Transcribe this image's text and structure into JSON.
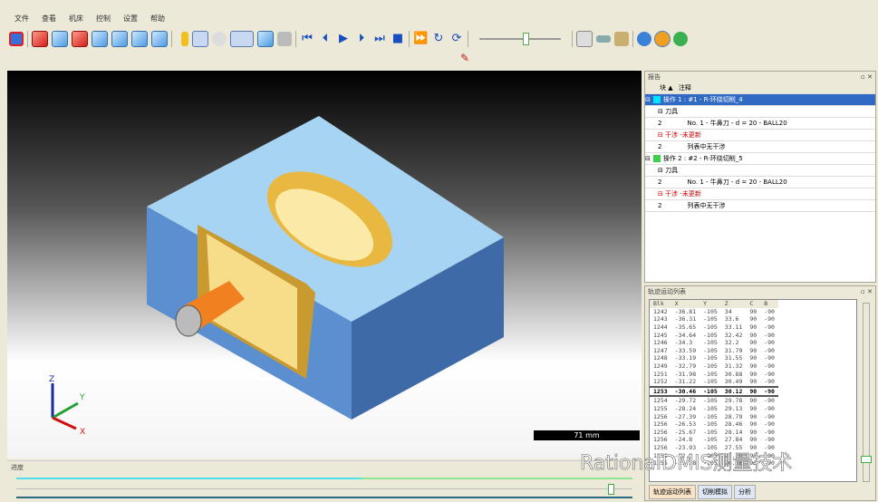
{
  "menu": [
    "文件",
    "查看",
    "机床",
    "控制",
    "设置",
    "帮助"
  ],
  "report": {
    "title": "报告",
    "col_block": "块",
    "col_note": "注释",
    "ops": [
      {
        "label": "操作 1 : #1 - R-环绕切削_4",
        "color": "#00e5ff",
        "tool_header": "刀具",
        "tool_block": "2",
        "tool": "No. 1 - 牛鼻刀 - d = 20 - BALL20",
        "coll_header": "干涉 -未更新",
        "coll_block": "2",
        "coll": "列表中无干涉"
      },
      {
        "label": "操作 2 : #2 - R-环绕切削_5",
        "color": "#3cd04a",
        "tool_header": "刀具",
        "tool_block": "2",
        "tool": "No. 1 - 牛鼻刀 - d = 20 - BALL20",
        "coll_header": "干涉 -未更新",
        "coll_block": "2",
        "coll": "列表中无干涉"
      }
    ]
  },
  "motion": {
    "title": "轨迹运动列表",
    "headers": [
      "Blk",
      "X",
      "Y",
      "Z",
      "C",
      "B"
    ],
    "current_row": 10,
    "rows": [
      [
        "1242",
        "-36.81",
        "-105",
        "34",
        "90",
        "-90"
      ],
      [
        "1243",
        "-36.31",
        "-105",
        "33.6",
        "90",
        "-90"
      ],
      [
        "1244",
        "-35.65",
        "-105",
        "33.11",
        "90",
        "-90"
      ],
      [
        "1245",
        "-34.64",
        "-105",
        "32.42",
        "90",
        "-90"
      ],
      [
        "1246",
        "-34.3",
        "-105",
        "32.2",
        "90",
        "-90"
      ],
      [
        "1247",
        "-33.59",
        "-105",
        "31.79",
        "90",
        "-90"
      ],
      [
        "1248",
        "-33.19",
        "-105",
        "31.55",
        "90",
        "-90"
      ],
      [
        "1249",
        "-32.79",
        "-105",
        "31.32",
        "90",
        "-90"
      ],
      [
        "1251",
        "-31.98",
        "-105",
        "30.88",
        "90",
        "-90"
      ],
      [
        "1252",
        "-31.22",
        "-105",
        "30.49",
        "90",
        "-90"
      ],
      [
        "1253",
        "-30.46",
        "-105",
        "30.12",
        "90",
        "-90"
      ],
      [
        "1254",
        "-29.72",
        "-105",
        "29.78",
        "90",
        "-90"
      ],
      [
        "1255",
        "-28.24",
        "-105",
        "29.13",
        "90",
        "-90"
      ],
      [
        "1256",
        "-27.39",
        "-105",
        "28.79",
        "90",
        "-90"
      ],
      [
        "1256",
        "-26.53",
        "-105",
        "28.46",
        "90",
        "-90"
      ],
      [
        "1256",
        "-25.67",
        "-105",
        "28.14",
        "90",
        "-90"
      ],
      [
        "1256",
        "-24.8",
        "-105",
        "27.84",
        "90",
        "-90"
      ],
      [
        "1256",
        "-23.93",
        "-105",
        "27.55",
        "90",
        "-90"
      ],
      [
        "1256",
        "-22.6",
        "-105",
        "27.16",
        "90",
        "-90"
      ],
      [
        "1256",
        "-21.28",
        "-105",
        "26.76",
        "90",
        "-90"
      ]
    ],
    "tabs": [
      "轨迹运动列表",
      "切削模拟",
      "分析"
    ]
  },
  "viewport": {
    "scale": "71 mm",
    "axes": {
      "x": "X",
      "y": "Y",
      "z": "Z"
    }
  },
  "progress": {
    "label": "进度",
    "value": 0.56,
    "slider": 0.96
  },
  "watermark": "RationalDMIS测量技术"
}
